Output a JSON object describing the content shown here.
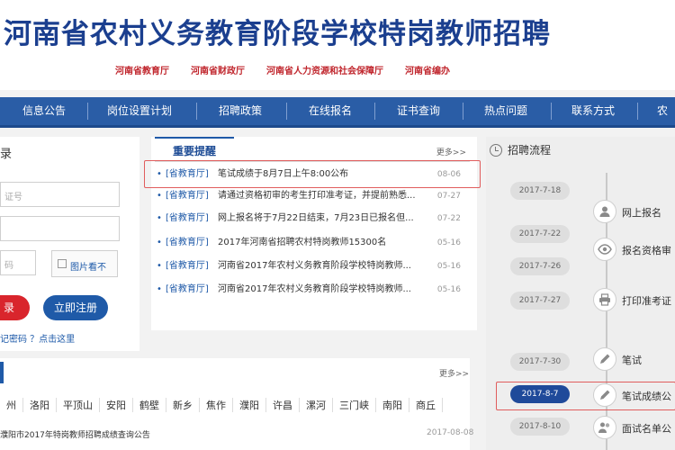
{
  "header": {
    "title": "河南省农村义务教育阶段学校特岗教师招聘",
    "departments": [
      "河南省教育厅",
      "河南省财政厅",
      "河南省人力资源和社会保障厅",
      "河南省编办"
    ]
  },
  "nav": [
    "信息公告",
    "岗位设置计划",
    "招聘政策",
    "在线报名",
    "证书查询",
    "热点问题",
    "联系方式",
    "农"
  ],
  "login": {
    "heading": "录",
    "field1_placeholder": "证号",
    "field2_placeholder": "",
    "captcha_placeholder": "码",
    "captcha_image_label": "图片看不",
    "login_button": "录",
    "register_button": "立即注册",
    "links": "记密码  ？点击这里"
  },
  "news": {
    "tab": "重要提醒",
    "more": "更多>>",
    "items": [
      {
        "source": "[省教育厅]",
        "title": "笔试成绩于8月7日上午8:00公布",
        "date": "08-06"
      },
      {
        "source": "[省教育厅]",
        "title": "请通过资格初审的考生打印准考证，并提前熟悉...",
        "date": "07-27"
      },
      {
        "source": "[省教育厅]",
        "title": "网上报名将于7月22日结束，7月23日已报名但...",
        "date": "07-22"
      },
      {
        "source": "[省教育厅]",
        "title": "2017年河南省招聘农村特岗教师15300名",
        "date": "05-16"
      },
      {
        "source": "[省教育厅]",
        "title": "河南省2017年农村义务教育阶段学校特岗教师...",
        "date": "05-16"
      },
      {
        "source": "[省教育厅]",
        "title": "河南省2017年农村义务教育阶段学校特岗教师...",
        "date": "05-16"
      }
    ]
  },
  "city": {
    "more": "更多>>",
    "cities": [
      "州",
      "洛阳",
      "平顶山",
      "安阳",
      "鹤壁",
      "新乡",
      "焦作",
      "濮阳",
      "许昌",
      "漯河",
      "三门峡",
      "南阳",
      "商丘"
    ],
    "footer_title": "濮阳市2017年特岗教师招聘成绩查询公告",
    "footer_date": "2017-08-08"
  },
  "process": {
    "heading": "招聘流程",
    "dates": [
      "2017-7-18",
      "2017-7-22",
      "2017-7-26",
      "2017-7-27",
      "2017-7-30",
      "2017-8-7",
      "2017-8-10"
    ],
    "steps": [
      {
        "label": "网上报名",
        "icon": "user-icon"
      },
      {
        "label": "报名资格审",
        "icon": "eye-icon"
      },
      {
        "label": "打印准考证",
        "icon": "printer-icon"
      },
      {
        "label": "笔试",
        "icon": "pencil-icon"
      },
      {
        "label": "笔试成绩公",
        "icon": "pencil-icon"
      },
      {
        "label": "面试名单公",
        "icon": "user-group-icon"
      }
    ],
    "active_date_index": 5
  }
}
